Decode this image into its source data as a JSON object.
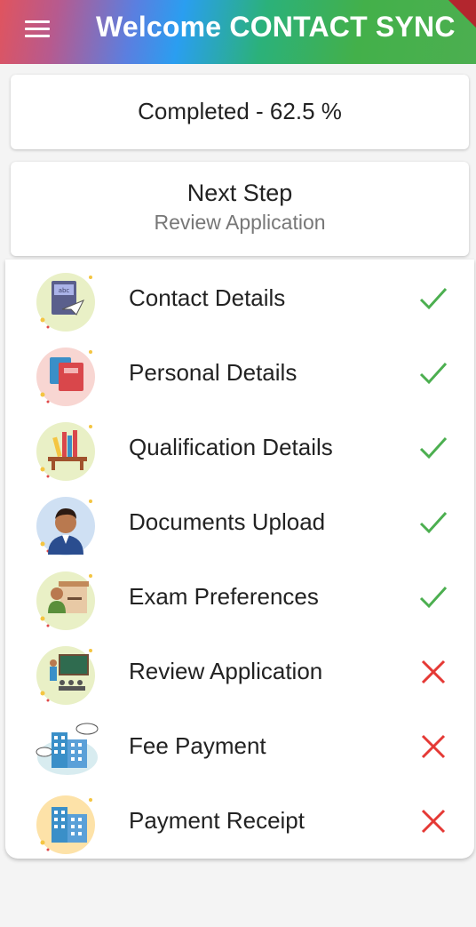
{
  "header": {
    "title": "Welcome CONTACT SYNC",
    "menu_icon": "menu-icon"
  },
  "progress": {
    "text": "Completed - 62.5 %",
    "value_percent": 62.5
  },
  "next_step": {
    "title": "Next Step",
    "subtitle": "Review Application"
  },
  "steps": [
    {
      "label": "Contact Details",
      "icon": "book-icon",
      "status": "completed"
    },
    {
      "label": "Personal Details",
      "icon": "books-icon",
      "status": "completed"
    },
    {
      "label": "Qualification Details",
      "icon": "bookshelf-icon",
      "status": "completed"
    },
    {
      "label": "Documents Upload",
      "icon": "person-icon",
      "status": "completed"
    },
    {
      "label": "Exam Preferences",
      "icon": "teacher-desk-icon",
      "status": "completed"
    },
    {
      "label": "Review Application",
      "icon": "classroom-icon",
      "status": "pending"
    },
    {
      "label": "Fee Payment",
      "icon": "building-cloud-icon",
      "status": "pending"
    },
    {
      "label": "Payment Receipt",
      "icon": "building-icon",
      "status": "pending"
    }
  ],
  "colors": {
    "check": "#4caf50",
    "cross": "#e53935"
  }
}
